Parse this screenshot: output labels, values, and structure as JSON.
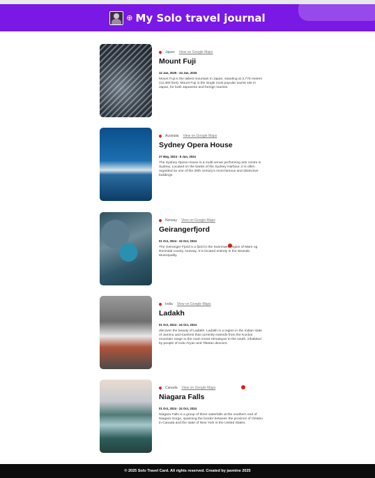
{
  "header": {
    "title": "My Solo travel journal",
    "globe_icon": "globe-icon",
    "avatar_icon": "avatar"
  },
  "entries": [
    {
      "country": "Japan",
      "maps_link": "View on Google Maps",
      "name": "Mount Fuji",
      "dates": "12 Jan, 2025 - 24 Jan, 2025",
      "description": "Mount Fuji is the tallest mountain in Japan, standing at 3,776 meters (12,380 feet). Mount Fuji is the single most popular tourist site in Japan, for both Japanese and foreign tourists."
    },
    {
      "country": "Australia",
      "maps_link": "View on Google Maps",
      "name": "Sydney Opera House",
      "dates": "27 May, 2024 - 8 Jun, 2024",
      "description": "The Sydney Opera House is a multi-venue performing arts centre in Sydney. Located on the banks of the Sydney Harbour, it is often regarded as one of the 20th century's most famous and distinctive buildings"
    },
    {
      "country": "Norway",
      "maps_link": "View on Google Maps",
      "name": "Geirangerfjord",
      "dates": "01 Oct, 2024 - 24 Oct, 2024",
      "description": "The Geiranger Fjord is a fjord in the Sunnmøre region of Møre og Romsdal county, Norway. It is located entirely in the Stranda Municipality."
    },
    {
      "country": "India",
      "maps_link": "View on Google Maps",
      "name": "Ladakh",
      "dates": "01 Oct, 2024 - 24 Oct, 2024",
      "description": "discover the beauty of Ladakh. Ladakh is a region in the Indian state of Jammu and Kashmir that currently extends from the Kunlun mountain range to the main Great Himalayas to the south, inhabited by people of Indo-Aryan and Tibetan descent."
    },
    {
      "country": "Canada",
      "maps_link": "View on Google Maps",
      "name": "Niagara Falls",
      "dates": "01 Oct, 2024 - 24 Oct, 2024",
      "description": "Niagara Falls is a group of three waterfalls at the southern end of Niagara Gorge, spanning the border between the province of Ontario in Canada and the state of New York in the United States."
    }
  ],
  "footer": {
    "text": "© 2025 Solo Travel Card. All rights reserved. Created by jasmine 2025"
  },
  "colors": {
    "header_bg": "#7a18e6",
    "footer_bg": "#0d0d0d",
    "pin": "#e02424"
  }
}
